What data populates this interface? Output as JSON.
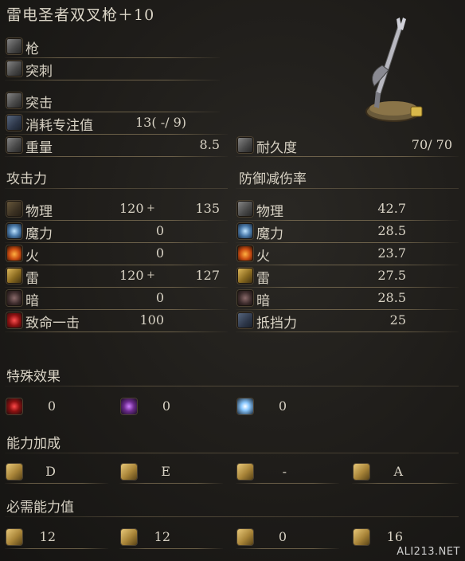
{
  "title": "雷电圣者双叉枪＋10",
  "weapon_info": {
    "type_label": "枪",
    "attack_type_label": "突刺",
    "skill_label": "突击",
    "fp_label": "消耗专注值",
    "fp_value": "13(  -/ 9)",
    "weight_label": "重量",
    "weight_value": "8.5",
    "durability_label": "耐久度",
    "durability_value": "70/   70"
  },
  "attack": {
    "header": "攻击力",
    "rows": [
      {
        "icon": "physical-attack-icon",
        "label": "物理",
        "base": "120",
        "plus": "+",
        "total": "135"
      },
      {
        "icon": "magic-attack-icon",
        "label": "魔力",
        "base": "0",
        "plus": "",
        "total": ""
      },
      {
        "icon": "fire-attack-icon",
        "label": "火",
        "base": "0",
        "plus": "",
        "total": ""
      },
      {
        "icon": "lightning-attack-icon",
        "label": "雷",
        "base": "120",
        "plus": "+",
        "total": "127"
      },
      {
        "icon": "dark-attack-icon",
        "label": "暗",
        "base": "0",
        "plus": "",
        "total": ""
      },
      {
        "icon": "critical-attack-icon",
        "label": "致命一击",
        "base": "100",
        "plus": "",
        "total": ""
      }
    ]
  },
  "defense": {
    "header": "防御减伤率",
    "rows": [
      {
        "icon": "physical-defense-icon",
        "label": "物理",
        "value": "42.7"
      },
      {
        "icon": "magic-defense-icon",
        "label": "魔力",
        "value": "28.5"
      },
      {
        "icon": "fire-defense-icon",
        "label": "火",
        "value": "23.7"
      },
      {
        "icon": "lightning-defense-icon",
        "label": "雷",
        "value": "27.5"
      },
      {
        "icon": "dark-defense-icon",
        "label": "暗",
        "value": "28.5"
      },
      {
        "icon": "stability-icon",
        "label": "抵挡力",
        "value": "25"
      }
    ]
  },
  "special_effects": {
    "header": "特殊效果",
    "items": [
      {
        "icon": "bleed-icon",
        "value": "0"
      },
      {
        "icon": "poison-icon",
        "value": "0"
      },
      {
        "icon": "frost-icon",
        "value": "0"
      }
    ]
  },
  "scaling": {
    "header": "能力加成",
    "items": [
      {
        "icon": "strength-icon",
        "value": "D"
      },
      {
        "icon": "dexterity-icon",
        "value": "E"
      },
      {
        "icon": "intelligence-icon",
        "value": "-"
      },
      {
        "icon": "faith-icon",
        "value": "A"
      }
    ]
  },
  "requirements": {
    "header": "必需能力值",
    "items": [
      {
        "icon": "strength-icon",
        "value": "12"
      },
      {
        "icon": "dexterity-icon",
        "value": "12"
      },
      {
        "icon": "intelligence-icon",
        "value": "0"
      },
      {
        "icon": "faith-icon",
        "value": "16"
      }
    ]
  },
  "watermark": "ALI213.NET"
}
